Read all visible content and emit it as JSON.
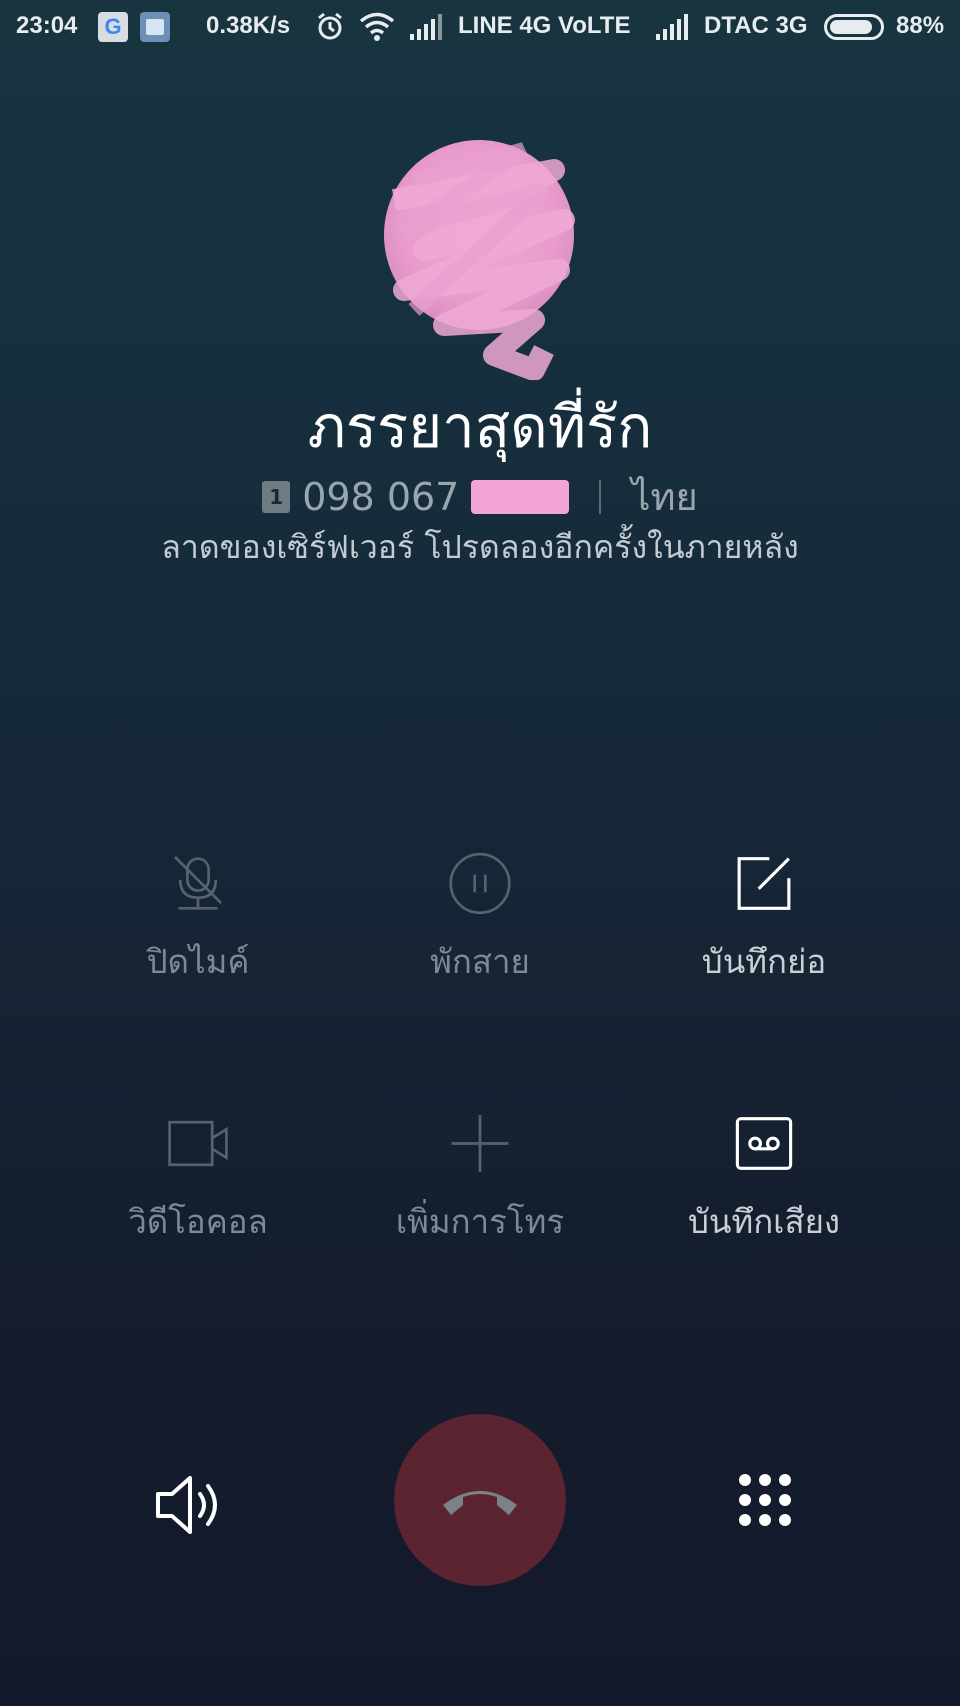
{
  "status_bar": {
    "time": "23:04",
    "net_speed": "0.38K/s",
    "carrier1": "LINE 4G  VoLTE",
    "carrier2": "DTAC 3G",
    "battery": "88%",
    "battery_level": 0.88
  },
  "caller": {
    "name": "ภรรยาสุดที่รัก",
    "sim": "1",
    "number": "098 067",
    "location": "ไทย",
    "status_message": "ลาดของเซิร์ฟเวอร์ โปรดลองอีกครั้งในภายหลัง"
  },
  "controls": {
    "mute": "ปิดไมค์",
    "hold": "พักสาย",
    "notes": "บันทึกย่อ",
    "video": "วิดีโอคอล",
    "add_call": "เพิ่มการโทร",
    "record": "บันทึกเสียง"
  },
  "colors": {
    "end_call": "#5c2430",
    "redaction": "#f2a5d6"
  },
  "icons": [
    "mic-off-icon",
    "pause-icon",
    "edit-note-icon",
    "video-icon",
    "plus-icon",
    "voicemail-icon",
    "speaker-icon",
    "phone-hangup-icon",
    "dialpad-icon"
  ]
}
